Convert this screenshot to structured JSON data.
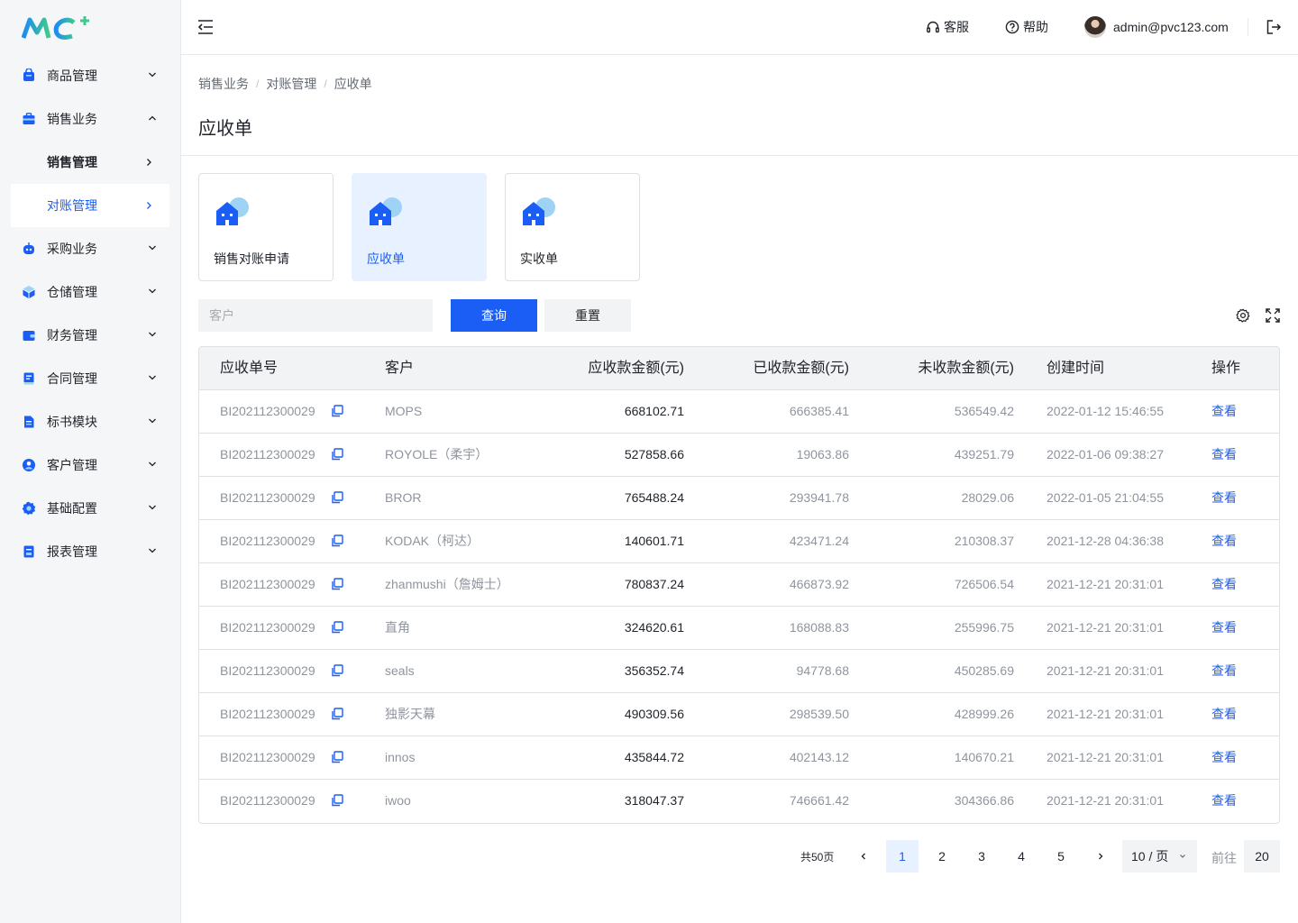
{
  "logo": {
    "text": "MC",
    "plus": "+"
  },
  "sidebar": {
    "items": [
      {
        "label": "商品管理",
        "icon": "goods-icon",
        "expanded": false
      },
      {
        "label": "销售业务",
        "icon": "briefcase-icon",
        "expanded": true
      },
      {
        "label": "销售管理",
        "sub": true
      },
      {
        "label": "对账管理",
        "sub": true,
        "active": true
      },
      {
        "label": "采购业务",
        "icon": "robot-icon",
        "expanded": false
      },
      {
        "label": "仓储管理",
        "icon": "cube-icon",
        "expanded": false
      },
      {
        "label": "财务管理",
        "icon": "wallet-icon",
        "expanded": false
      },
      {
        "label": "合同管理",
        "icon": "contract-icon",
        "expanded": false
      },
      {
        "label": "标书模块",
        "icon": "document-icon",
        "expanded": false
      },
      {
        "label": "客户管理",
        "icon": "user-icon",
        "expanded": false
      },
      {
        "label": "基础配置",
        "icon": "gear-icon",
        "expanded": false
      },
      {
        "label": "报表管理",
        "icon": "report-icon",
        "expanded": false
      }
    ]
  },
  "header": {
    "service_label": "客服",
    "help_label": "帮助",
    "user_email": "admin@pvc123.com"
  },
  "breadcrumb": [
    "销售业务",
    "对账管理",
    "应收单"
  ],
  "page_title": "应收单",
  "cards": [
    {
      "label": "销售对账申请",
      "active": false
    },
    {
      "label": "应收单",
      "active": true
    },
    {
      "label": "实收单",
      "active": false
    }
  ],
  "search": {
    "customer_placeholder": "客户",
    "query_label": "查询",
    "reset_label": "重置"
  },
  "table": {
    "columns": [
      "应收单号",
      "客户",
      "应收款金额(元)",
      "已收款金额(元)",
      "未收款金额(元)",
      "创建时间",
      "操作"
    ],
    "rows": [
      [
        "BI202112300029",
        "MOPS",
        "668102.71",
        "666385.41",
        "536549.42",
        "2022-01-12 15:46:55",
        "查看"
      ],
      [
        "BI202112300029",
        "ROYOLE（柔宇）",
        "527858.66",
        "19063.86",
        "439251.79",
        "2022-01-06 09:38:27",
        "查看"
      ],
      [
        "BI202112300029",
        "BROR",
        "765488.24",
        "293941.78",
        "28029.06",
        "2022-01-05 21:04:55",
        "查看"
      ],
      [
        "BI202112300029",
        "KODAK（柯达）",
        "140601.71",
        "423471.24",
        "210308.37",
        "2021-12-28 04:36:38",
        "查看"
      ],
      [
        "BI202112300029",
        "zhanmushi（詹姆士）",
        "780837.24",
        "466873.92",
        "726506.54",
        "2021-12-21 20:31:01",
        "查看"
      ],
      [
        "BI202112300029",
        "直角",
        "324620.61",
        "168088.83",
        "255996.75",
        "2021-12-21 20:31:01",
        "查看"
      ],
      [
        "BI202112300029",
        "seals",
        "356352.74",
        "94778.68",
        "450285.69",
        "2021-12-21 20:31:01",
        "查看"
      ],
      [
        "BI202112300029",
        "独影天幕",
        "490309.56",
        "298539.50",
        "428999.26",
        "2021-12-21 20:31:01",
        "查看"
      ],
      [
        "BI202112300029",
        "innos",
        "435844.72",
        "402143.12",
        "140670.21",
        "2021-12-21 20:31:01",
        "查看"
      ],
      [
        "BI202112300029",
        "iwoo",
        "318047.37",
        "746661.42",
        "304366.86",
        "2021-12-21 20:31:01",
        "查看"
      ]
    ]
  },
  "pagination": {
    "total_label": "共50页",
    "pages": [
      "1",
      "2",
      "3",
      "4",
      "5"
    ],
    "current": "1",
    "page_size": "10 / 页",
    "goto_label": "前往",
    "goto_value": "20"
  },
  "colors": {
    "primary": "#1b5ef5",
    "active_bg": "#e8f1ff",
    "sidebar_bg": "#f5f6f8"
  }
}
